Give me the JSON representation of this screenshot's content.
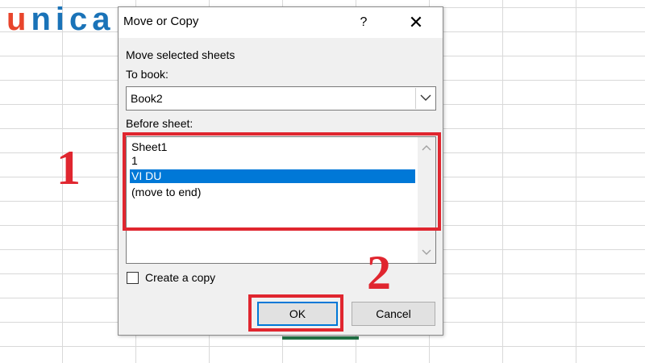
{
  "logo": {
    "first_letter": "u",
    "rest": "nica"
  },
  "dialog": {
    "title": "Move or Copy",
    "help_glyph": "?",
    "close_glyph": "✕",
    "move_label": "Move selected sheets",
    "to_book_label": "To book:",
    "to_book_value": "Book2",
    "before_sheet_label": "Before sheet:",
    "sheets": [
      {
        "label": "Sheet1",
        "selected": false
      },
      {
        "label": "1",
        "selected": false
      },
      {
        "label": "VI DU",
        "selected": true
      },
      {
        "label": "(move to end)",
        "selected": false
      }
    ],
    "create_copy_label": "Create a copy",
    "create_copy_checked": false,
    "ok_label": "OK",
    "cancel_label": "Cancel"
  },
  "annotations": {
    "step1": "1",
    "step2": "2",
    "highlight_color": "#e0262f"
  },
  "colors": {
    "selection": "#0078d7",
    "grid_selection": "#217346"
  }
}
